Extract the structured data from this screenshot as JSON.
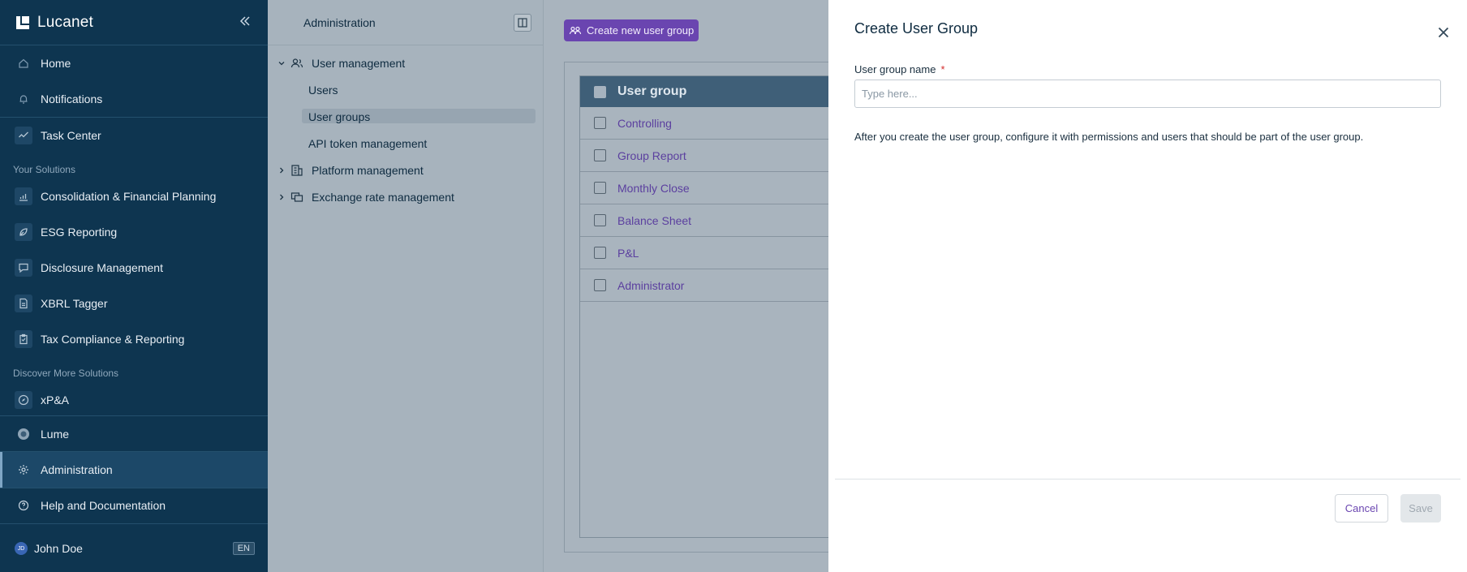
{
  "sidebar": {
    "brand": "Lucanet",
    "items": {
      "home": "Home",
      "notifications": "Notifications",
      "task_center": "Task Center",
      "consolidation": "Consolidation & Financial Planning",
      "esg": "ESG Reporting",
      "disclosure": "Disclosure Management",
      "xbrl": "XBRL Tagger",
      "tax": "Tax Compliance & Reporting",
      "xpa": "xP&A",
      "lume": "Lume",
      "administration": "Administration",
      "help": "Help and Documentation"
    },
    "sections": {
      "your_solutions": "Your Solutions",
      "discover_more": "Discover More Solutions"
    },
    "user": {
      "initials": "JD",
      "name": "John Doe",
      "language": "EN"
    }
  },
  "admin_panel": {
    "title": "Administration",
    "tree": {
      "user_management": "User management",
      "users": "Users",
      "user_groups": "User groups",
      "api_tokens": "API token management",
      "platform_management": "Platform management",
      "exchange_rate": "Exchange rate management"
    }
  },
  "content": {
    "create_button": "Create new user group",
    "table": {
      "header": "User group",
      "rows": [
        "Controlling",
        "Group Report",
        "Monthly Close",
        "Balance Sheet",
        "P&L",
        "Administrator"
      ]
    }
  },
  "modal": {
    "title": "Create User Group",
    "field_label": "User group name",
    "required_mark": "*",
    "placeholder": "Type here...",
    "helper_text": "After you create the user group, configure it with permissions and users that should be part of the user group.",
    "cancel": "Cancel",
    "save": "Save"
  },
  "colors": {
    "sidebar_bg": "#0e3550",
    "accent": "#6a45b0",
    "table_header": "#3f5f78",
    "overlay": "#a9b4be"
  }
}
